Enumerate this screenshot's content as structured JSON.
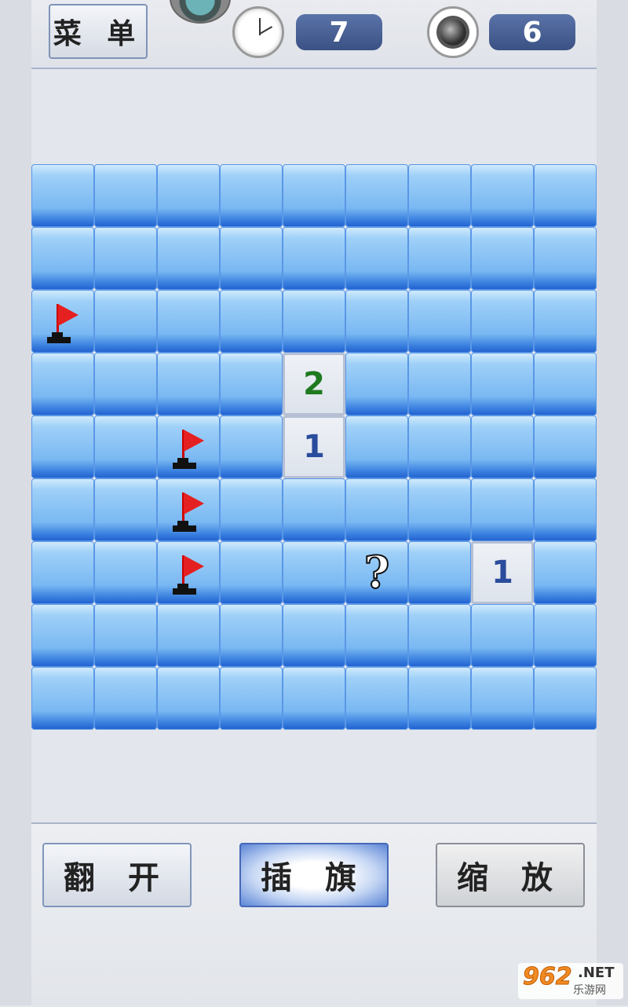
{
  "topbar": {
    "menu_label": "菜 单",
    "timer_value": "7",
    "mines_value": "6",
    "timer_icon": "clock-icon",
    "mines_icon": "mine-icon"
  },
  "board": {
    "cols": 9,
    "rows": 9,
    "open_cells": [
      {
        "row": 3,
        "col": 4,
        "label": "2",
        "color": "#1f7a1f"
      },
      {
        "row": 4,
        "col": 4,
        "label": "1",
        "color": "#2a4c9c"
      },
      {
        "row": 6,
        "col": 7,
        "label": "1",
        "color": "#2a4c9c"
      }
    ],
    "flags": [
      {
        "row": 2,
        "col": 0
      },
      {
        "row": 4,
        "col": 2
      },
      {
        "row": 5,
        "col": 2
      },
      {
        "row": 6,
        "col": 2
      }
    ],
    "questions": [
      {
        "row": 6,
        "col": 5,
        "label": "?"
      }
    ]
  },
  "actions": {
    "open_label": "翻 开",
    "flag_label": "插 旗",
    "zoom_label": "缩 放"
  },
  "watermark": {
    "logo": "962",
    "net": ".NET",
    "sub": "乐游网"
  },
  "colors": {
    "tile_blue": "#79b8f2",
    "number_green": "#1f7a1f",
    "number_blue": "#2a4c9c",
    "flag_red": "#e52020"
  }
}
